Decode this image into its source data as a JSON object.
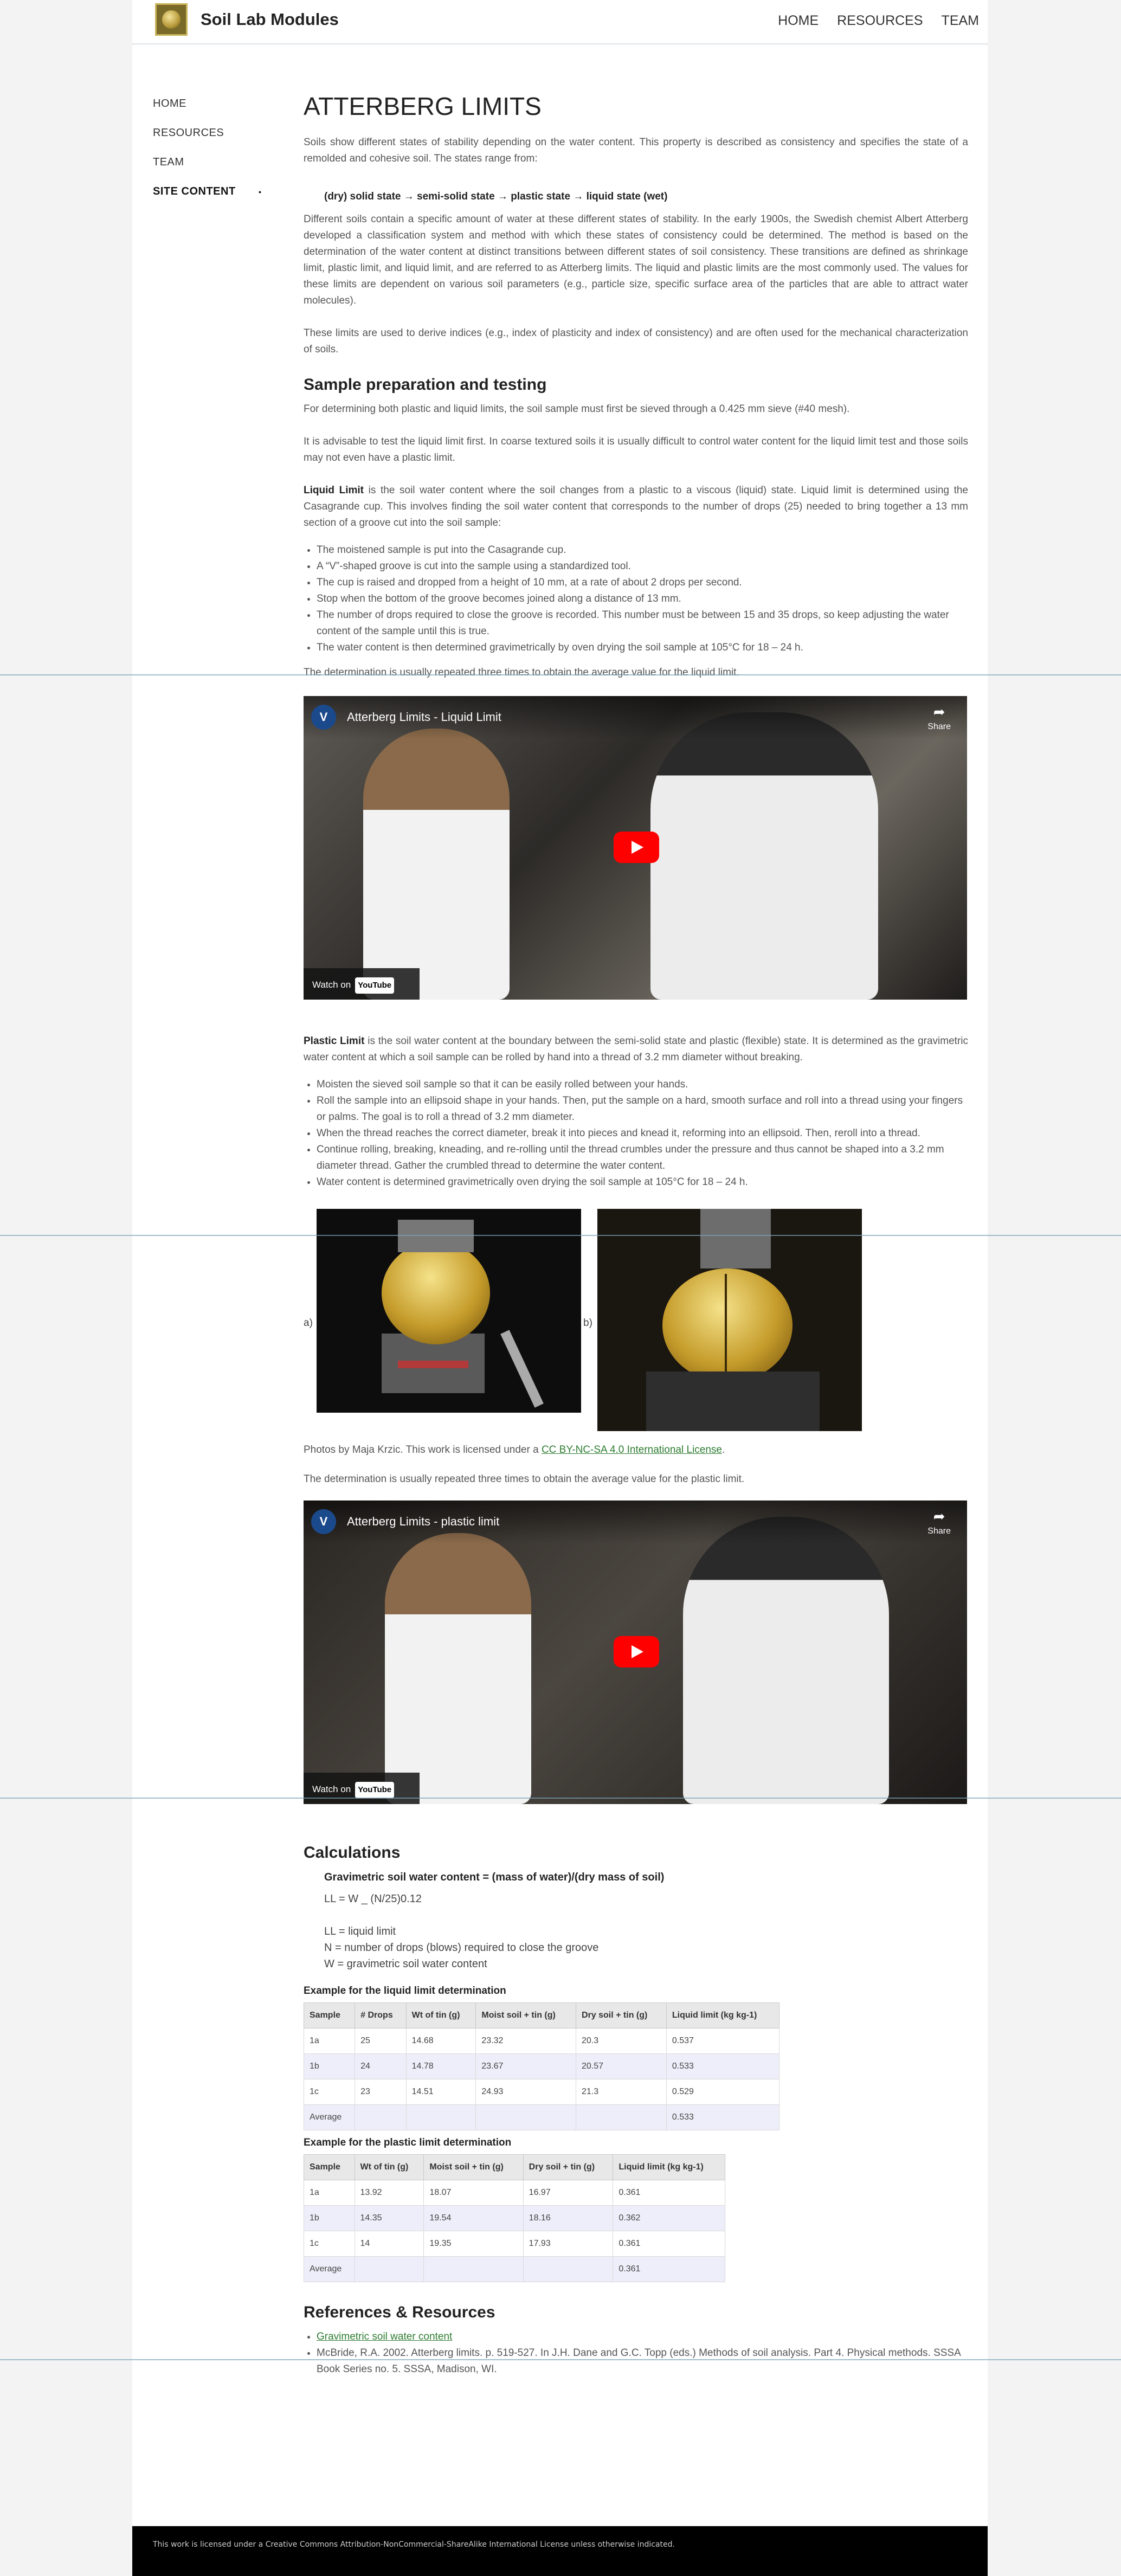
{
  "header": {
    "site_title": "Soil Lab Modules",
    "nav": [
      "HOME",
      "RESOURCES",
      "TEAM"
    ]
  },
  "sidenav": {
    "items": [
      "HOME",
      "RESOURCES",
      "TEAM",
      "SITE CONTENT"
    ],
    "bullet": "•"
  },
  "main": {
    "title": "ATTERBERG LIMITS",
    "intro": "Soils show different states of stability depending on the water content. This property is described as consistency and specifies the state of a remolded and cohesive soil. The states range from:",
    "states": "(dry) solid state → semi-solid state → plastic state → liquid state (wet)",
    "para2": "Different soils contain a specific amount of water at these different states of stability. In the early 1900s, the Swedish chemist Albert Atterberg developed a classification system and method with which these states of consistency could be determined. The method is based on the determination of the water content at distinct transitions between different states of soil consistency. These transitions are defined as shrinkage limit, plastic limit, and liquid limit, and are referred to as Atterberg limits. The liquid and plastic limits are the most commonly used. The values for these limits are dependent on various soil parameters (e.g., particle size, specific surface area of the particles that are able to attract water molecules).",
    "para3": "These limits are used to derive indices (e.g., index of plasticity and index of consistency) and are often used for the mechanical characterization of soils.",
    "section1_title": "Sample preparation and testing",
    "s1_p1": "For determining both plastic and liquid limits, the soil sample must first be sieved through a 0.425 mm sieve (#40 mesh).",
    "s1_p2": "It is advisable to test the liquid limit first. In coarse textured soils it is usually difficult to control water content for the liquid limit test and those soils may not even have a plastic limit.",
    "ll_label": "Liquid Limit",
    "ll_text": " is the soil water content where the soil changes from a plastic to a viscous (liquid) state. Liquid limit is determined using the Casagrande cup. This involves finding the soil water content that corresponds to the number of drops (25) needed to bring together a 13 mm section of a groove cut into the soil sample:",
    "ll_steps": [
      "The moistened sample is put into the Casagrande cup.",
      "A “V”-shaped groove is cut into the sample using a standardized tool.",
      "The cup is raised and dropped from a height of 10 mm, at a rate of about 2 drops per second.",
      "Stop when the bottom of the groove becomes joined along a distance of 13 mm.",
      "The number of drops required to close the groove is recorded. This number must be between 15 and 35 drops, so keep adjusting the water content of the sample until this is true.",
      "The water content is then determined gravimetrically by oven drying the soil sample at 105°C for 18 – 24 h."
    ],
    "ll_repeat": "The determination is usually repeated three times to obtain the average value for the liquid limit.",
    "video1": {
      "title": "Atterberg Limits - Liquid Limit",
      "share": "Share",
      "watch": "Watch on",
      "yt": "YouTube",
      "avatar": "V"
    },
    "pl_label": "Plastic Limit",
    "pl_text": " is the soil water content at the boundary between the semi-solid state and plastic (flexible) state. It is determined as the gravimetric water content at which a soil sample can be rolled by hand into a thread of 3.2 mm diameter without breaking.",
    "pl_steps": [
      "Moisten the sieved soil sample so that it can be easily rolled between your hands.",
      "Roll the sample into an ellipsoid shape in your hands. Then, put the sample on a hard, smooth surface and roll into a thread using your fingers or palms. The goal is to roll a thread of 3.2 mm diameter.",
      "When the thread reaches the correct diameter, break it into pieces and knead it, reforming into an ellipsoid. Then, reroll into a thread.",
      "Continue rolling, breaking, kneading, and re-rolling until the thread crumbles under the pressure and thus cannot be shaped into a 3.2 mm diameter thread. Gather the crumbled thread to determine the water content.",
      "Water content is determined gravimetrically oven drying the soil sample at 105°C for 18 – 24 h."
    ],
    "photo_a": "a)",
    "photo_b": "b)",
    "credit_prefix": "Photos by Maja Krzic. This work is licensed under a ",
    "credit_link": "CC BY-NC-SA 4.0 International License",
    "credit_suffix": ".",
    "pl_repeat": "The determination is usually repeated three times to obtain the average value for the plastic limit.",
    "video2": {
      "title": "Atterberg Limits - plastic limit",
      "share": "Share",
      "watch": "Watch on",
      "yt": "YouTube",
      "avatar": "V"
    },
    "calc_title": "Calculations",
    "calc_formula": "Gravimetric soil water content = (mass of water)/(dry mass of soil)",
    "calc_ll": "LL = W _ (N/25)0.12",
    "calc_def1": "LL = liquid limit",
    "calc_def2": "N = number of drops (blows) required to close the groove",
    "calc_def3": "W = gravimetric soil water content",
    "table1_caption": "Example for the liquid limit determination",
    "table1_headers": [
      "Sample",
      "# Drops",
      "Wt of tin (g)",
      "Moist soil + tin (g)",
      "Dry soil + tin (g)",
      "Liquid limit (kg kg-1)"
    ],
    "table1_rows": [
      [
        "1a",
        "25",
        "14.68",
        "23.32",
        "20.3",
        "0.537"
      ],
      [
        "1b",
        "24",
        "14.78",
        "23.67",
        "20.57",
        "0.533"
      ],
      [
        "1c",
        "23",
        "14.51",
        "24.93",
        "21.3",
        "0.529"
      ],
      [
        "Average",
        "",
        "",
        "",
        "",
        "0.533"
      ]
    ],
    "table2_caption": "Example for the plastic limit determination",
    "table2_headers": [
      "Sample",
      "Wt of tin (g)",
      "Moist soil + tin (g)",
      "Dry soil + tin (g)",
      "Liquid limit (kg kg-1)"
    ],
    "table2_rows": [
      [
        "1a",
        "13.92",
        "18.07",
        "16.97",
        "0.361"
      ],
      [
        "1b",
        "14.35",
        "19.54",
        "18.16",
        "0.362"
      ],
      [
        "1c",
        "14",
        "19.35",
        "17.93",
        "0.361"
      ],
      [
        "Average",
        "",
        "",
        "",
        "0.361"
      ]
    ],
    "refs_title": "References & Resources",
    "ref1": "Gravimetric soil water content",
    "ref2": "McBride, R.A. 2002. Atterberg limits. p. 519-527. In J.H. Dane and G.C. Topp (eds.) Methods of soil analysis. Part 4. Physical methods. SSSA Book Series no. 5. SSSA, Madison, WI."
  },
  "footer": {
    "text": "This work is licensed under a Creative Commons Attribution-NonCommercial-ShareAlike International License unless otherwise indicated."
  }
}
